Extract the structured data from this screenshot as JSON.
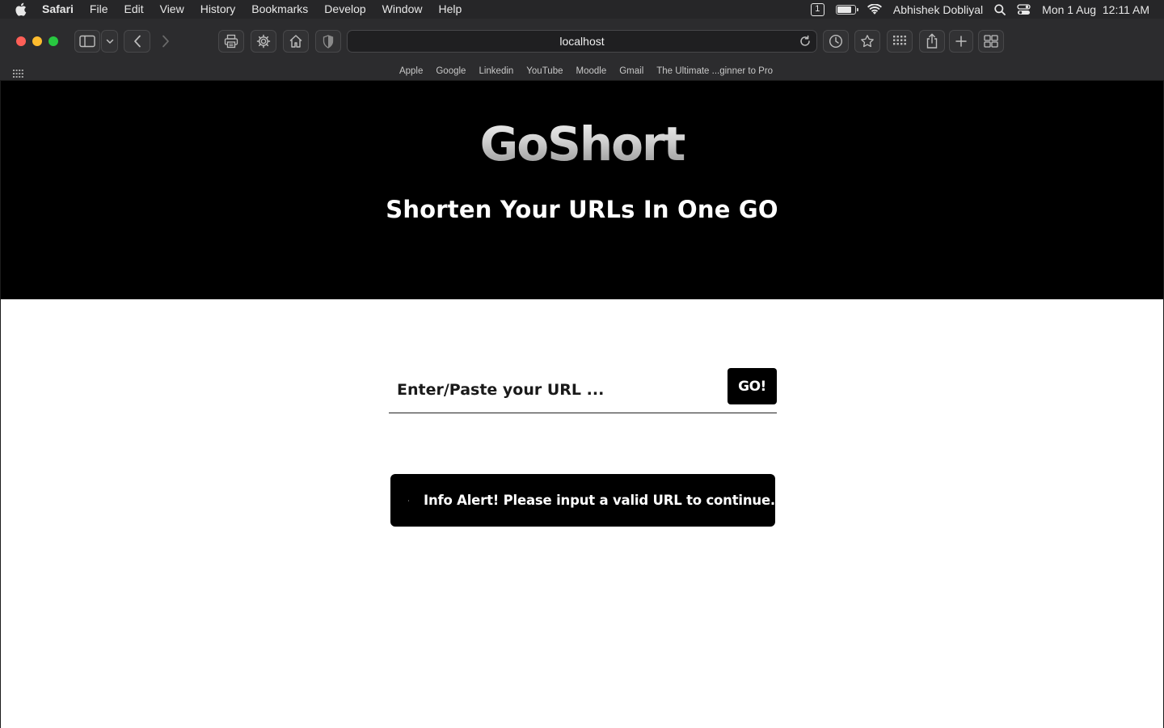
{
  "menubar": {
    "app_name": "Safari",
    "menus": [
      "File",
      "Edit",
      "View",
      "History",
      "Bookmarks",
      "Develop",
      "Window",
      "Help"
    ],
    "screen_badge": "1",
    "battery_level": 0.8,
    "user_name": "Abhishek Dobliyal",
    "datetime": "Mon 1 Aug  12:11 AM"
  },
  "toolbar": {
    "traffic_colors": [
      "#fe5f57",
      "#febc2e",
      "#28c840"
    ],
    "address": "localhost"
  },
  "bookmarks": [
    "Apple",
    "Google",
    "Linkedin",
    "YouTube",
    "Moodle",
    "Gmail",
    "The Ultimate ...ginner to Pro"
  ],
  "page": {
    "logo": "GoShort",
    "tagline": "Shorten Your URLs In One GO",
    "url_placeholder": "Enter/Paste your URL ...",
    "url_value": "",
    "go_label": "GO!",
    "alert_message": "Info Alert! Please input a valid URL to continue."
  }
}
